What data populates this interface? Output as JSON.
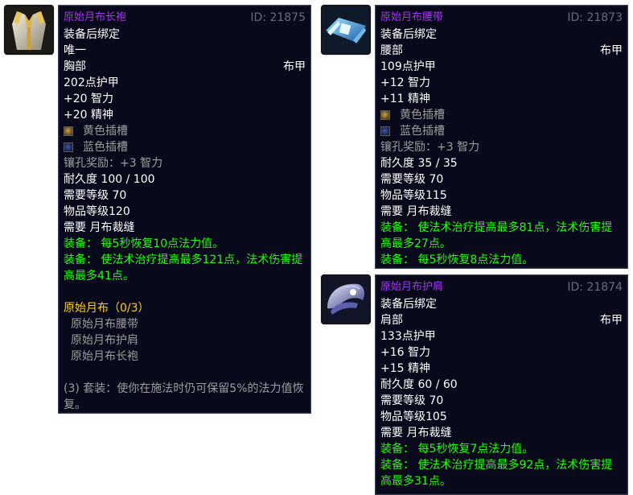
{
  "tooltips": {
    "robe": {
      "name": "原始月布长袍",
      "id_text": "ID: 21875",
      "bind": "装备后绑定",
      "unique": "唯一",
      "slot": "胸部",
      "armor_type": "布甲",
      "armor": "202点护甲",
      "stat1": "+20 智力",
      "stat2": "+20 精神",
      "socket1": "黄色插槽",
      "socket2": "蓝色插槽",
      "socket_bonus": "镶孔奖励：+3 智力",
      "durability": "耐久度 100 / 100",
      "req_level": "需要等级 70",
      "item_level": "物品等级120",
      "req_skill": "需要 月布裁缝",
      "equip1": "装备： 每5秒恢复10点法力值。",
      "equip2": "装备： 使法术治疗提高最多121点，法术伤害提高最多41点。",
      "set_name": "原始月布（0/3）",
      "set_items": [
        "原始月布腰带",
        "原始月布护肩",
        "原始月布长袍"
      ],
      "set_bonus": "(3) 套装：使你在施法时仍可保留5%的法力值恢复。"
    },
    "belt": {
      "name": "原始月布腰带",
      "id_text": "ID: 21873",
      "bind": "装备后绑定",
      "slot": "腰部",
      "armor_type": "布甲",
      "armor": "109点护甲",
      "stat1": "+12 智力",
      "stat2": "+11 精神",
      "socket1": "黄色插槽",
      "socket2": "蓝色插槽",
      "socket_bonus": "镶孔奖励：+3 智力",
      "durability": "耐久度 35 / 35",
      "req_level": "需要等级 70",
      "item_level": "物品等级115",
      "req_skill": "需要 月布裁缝",
      "equip1": "装备： 使法术治疗提高最多81点，法术伤害提高最多27点。",
      "equip2": "装备： 每5秒恢复8点法力值。"
    },
    "shoulders": {
      "name": "原始月布护肩",
      "id_text": "ID: 21874",
      "bind": "装备后绑定",
      "slot": "肩部",
      "armor_type": "布甲",
      "armor": "133点护甲",
      "stat1": "+16 智力",
      "stat2": "+15 精神",
      "durability": "耐久度 60 / 60",
      "req_level": "需要等级 70",
      "item_level": "物品等级105",
      "req_skill": "需要 月布裁缝",
      "equip1": "装备： 每5秒恢复7点法力值。",
      "equip2": "装备： 使法术治疗提高最多92点，法术伤害提高最多31点。"
    }
  },
  "icons": {
    "robe": "robe-chest-icon",
    "belt": "belt-icon",
    "shoulders": "shoulder-icon"
  },
  "colors": {
    "epic_name": "#a335ee",
    "equip_green": "#1eff00",
    "set_gold": "#ffd100",
    "gray": "#9d9d9d",
    "tooltip_bg": "#080a1c"
  }
}
